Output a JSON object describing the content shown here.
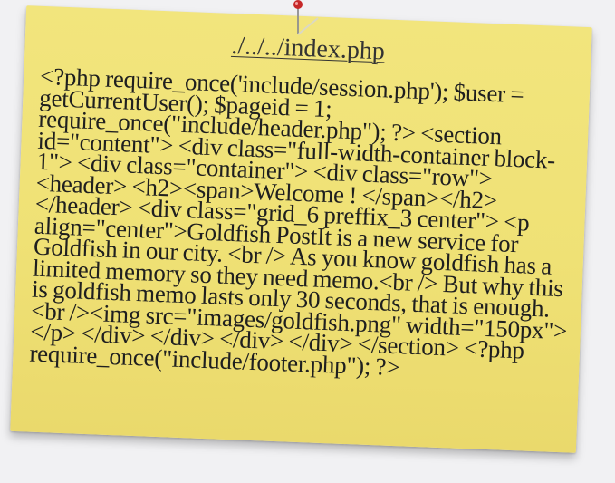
{
  "note": {
    "title": "./../../index.php",
    "body": "<?php require_once('include/session.php'); $user = getCurrentUser(); $pageid = 1; require_once(\"include/header.php\"); ?> <section id=\"content\"> <div class=\"full-width-container block-1\"> <div class=\"container\"> <div class=\"row\"> <header> <h2><span>Welcome ! </span></h2> </header> <div class=\"grid_6 preffix_3 center\"> <p align=\"center\">Goldfish PostIt is a new service for Goldfish in our city. <br /> As you know goldfish has a limited memory so they need memo.<br /> But why this is goldfish memo lasts only 30 seconds, that is enough.<br /><img src=\"images/goldfish.png\" width=\"150px\"></p> </div> </div> </div> </div> </section> <?php require_once(\"include/footer.php\"); ?>"
  },
  "colors": {
    "note_background": "#efe175",
    "pin_head": "#c62828",
    "text": "#1f1f1f"
  },
  "icons": {
    "pin": "push-pin-icon"
  }
}
